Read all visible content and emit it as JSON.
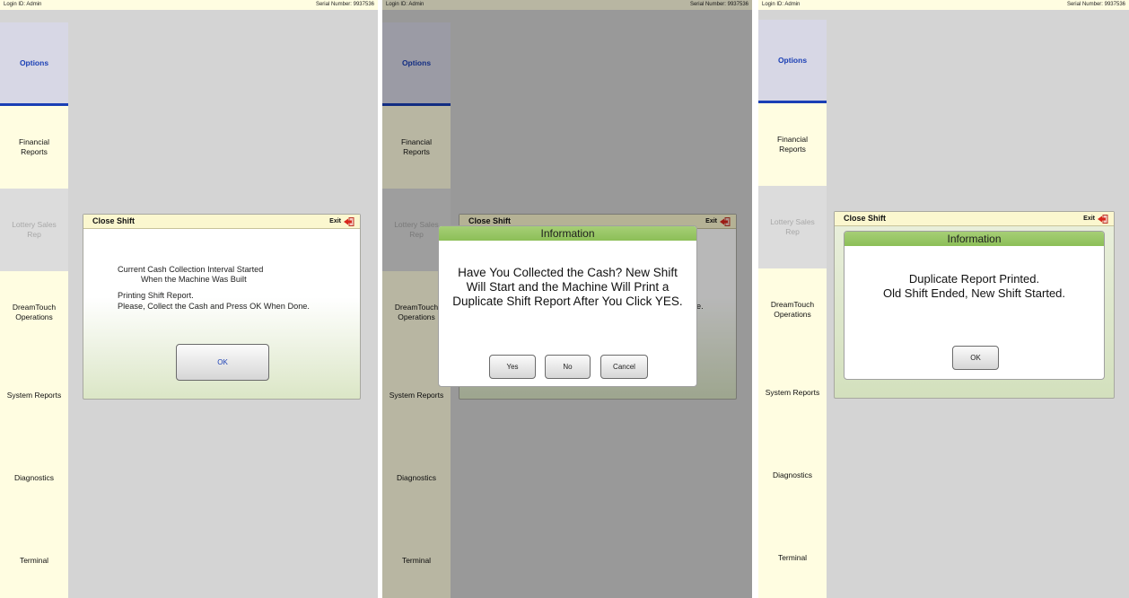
{
  "top_bar": {
    "login": "Login ID: Admin",
    "serial": "Serial Number: 9937536"
  },
  "sidebar": {
    "items": [
      {
        "label": "Options",
        "state": "active"
      },
      {
        "label": "Financial\nReports",
        "state": "normal"
      },
      {
        "label": "Lottery Sales\nRep",
        "state": "disabled"
      },
      {
        "label": "DreamTouch\nOperations",
        "state": "normal"
      },
      {
        "label": "System Reports",
        "state": "normal"
      },
      {
        "label": "Diagnostics",
        "state": "normal"
      },
      {
        "label": "Terminal",
        "state": "normal"
      }
    ]
  },
  "dialog": {
    "title": "Close Shift",
    "exit_label": "Exit"
  },
  "panel1": {
    "line1": "Current Cash Collection Interval Started",
    "line2": "When the Machine Was Built",
    "line3": "Printing Shift Report.",
    "line4": "Please, Collect the Cash and Press OK When Done.",
    "ok_label": "OK",
    "partial_text": "e."
  },
  "panel2": {
    "info_title": "Information",
    "message_line1": "Have You Collected the Cash? New Shift",
    "message_line2": "Will Start and the Machine Will Print a",
    "message_line3": "Duplicate Shift Report After You Click YES.",
    "yes_label": "Yes",
    "no_label": "No",
    "cancel_label": "Cancel"
  },
  "panel3": {
    "info_title": "Information",
    "message_line1": "Duplicate Report Printed.",
    "message_line2": "Old Shift Ended, New Shift Started.",
    "ok_label": "OK"
  },
  "colors": {
    "accent": "#1a3fb5",
    "info_header": "#9bc86a",
    "sidebar_bg": "#fffde1",
    "content_bg": "#d4d4d4"
  },
  "icons": {
    "exit": "exit-door-arrow-icon"
  }
}
